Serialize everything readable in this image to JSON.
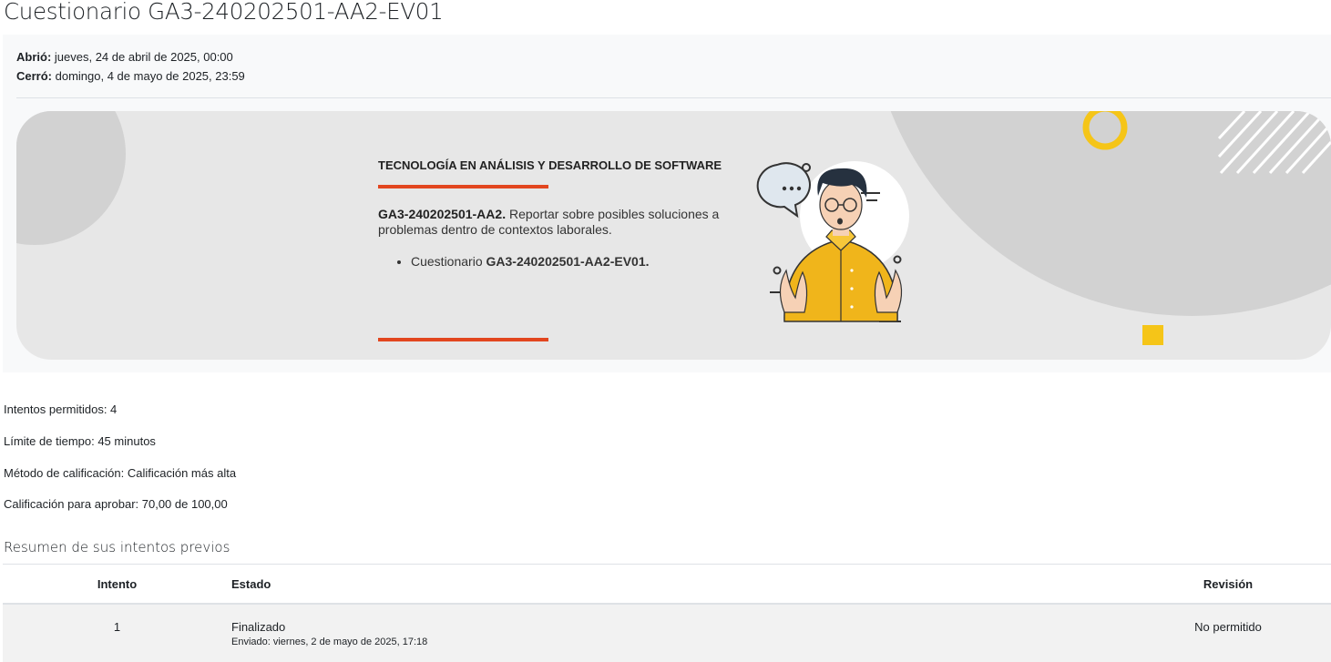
{
  "page": {
    "title": "Cuestionario GA3-240202501-AA2-EV01"
  },
  "dates": {
    "opened_label": "Abrió:",
    "opened_value": " jueves, 24 de abril de 2025, 00:00",
    "closed_label": "Cerró:",
    "closed_value": " domingo, 4 de mayo de 2025, 23:59"
  },
  "banner": {
    "heading": "TECNOLOGÍA EN ANÁLISIS Y DESARROLLO DE SOFTWARE",
    "desc_code": "GA3-240202501-AA2.",
    "desc_text": " Reportar sobre posibles soluciones a problemas dentro de contextos laborales.",
    "list_prefix": "Cuestionario ",
    "list_code": "GA3-240202501-AA2-EV01.",
    "colors": {
      "accent": "#e2461f",
      "yellow": "#f5c518",
      "shirt": "#f0b51b"
    }
  },
  "quiz_info": {
    "attempts": "Intentos permitidos: 4",
    "time_limit": "Límite de tiempo: 45 minutos",
    "grading_method": "Método de calificación: Calificación más alta",
    "passing_grade": "Calificación para aprobar: 70,00 de 100,00"
  },
  "summary": {
    "heading": "Resumen de sus intentos previos",
    "columns": [
      "Intento",
      "Estado",
      "Revisión"
    ],
    "rows": [
      {
        "attempt": "1",
        "status": "Finalizado",
        "submitted": "Enviado: viernes, 2 de mayo de 2025, 17:18",
        "review": "No permitido"
      }
    ]
  }
}
